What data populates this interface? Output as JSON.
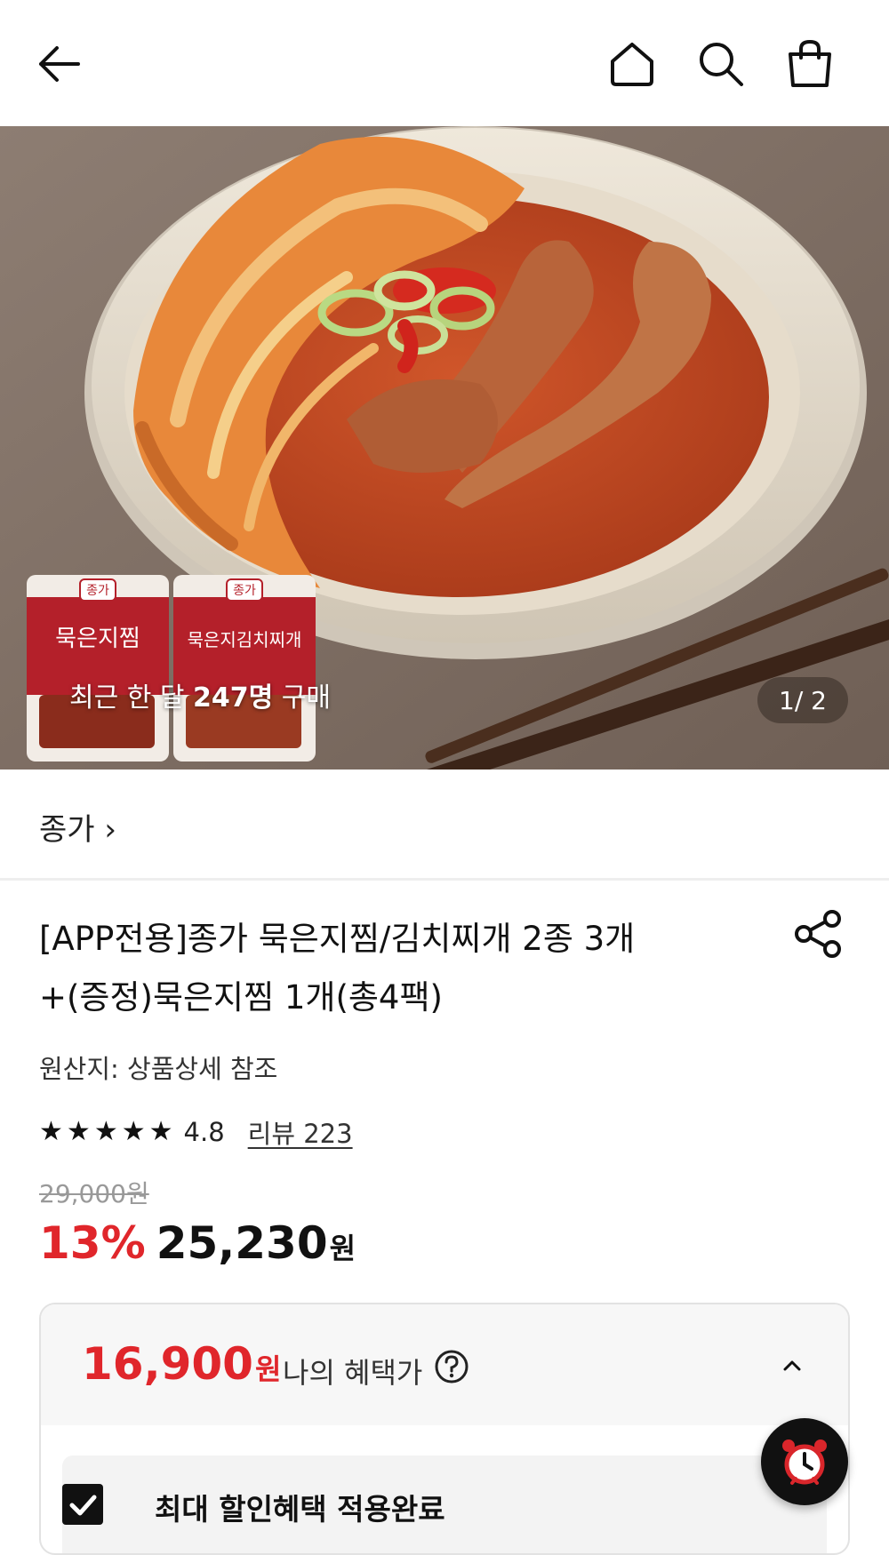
{
  "header": {
    "back_icon": "back-arrow-icon",
    "home_icon": "home-icon",
    "search_icon": "search-icon",
    "cart_icon": "shopping-bag-icon"
  },
  "hero": {
    "purchase_prefix": "최근 한 달 ",
    "purchase_count": "247명",
    "purchase_suffix": " 구매",
    "page_counter": "1/ 2",
    "package_labels": [
      "종가",
      "묵은지찜",
      "종가",
      "묵은지김치찌개"
    ]
  },
  "brand": {
    "name": "종가 ›"
  },
  "product": {
    "title_line1": "[APP전용]종가 묵은지찜/김치찌개 2종 3개",
    "title_line2": "+(증정)묵은지찜 1개(총4팩)",
    "origin": "원산지: 상품상세 참조",
    "rating": "4.8",
    "review_link": "리뷰 223",
    "stars": 5,
    "original_price": "29,000원",
    "discount": "13%",
    "sale_price": "25,230",
    "currency": "원"
  },
  "benefit": {
    "amount": "16,900",
    "currency": "원",
    "label": "나의 혜택가",
    "applied_text": "최대 할인혜택 적용완료"
  },
  "colors": {
    "accent_red": "#e0262b",
    "text_dark": "#111111"
  }
}
